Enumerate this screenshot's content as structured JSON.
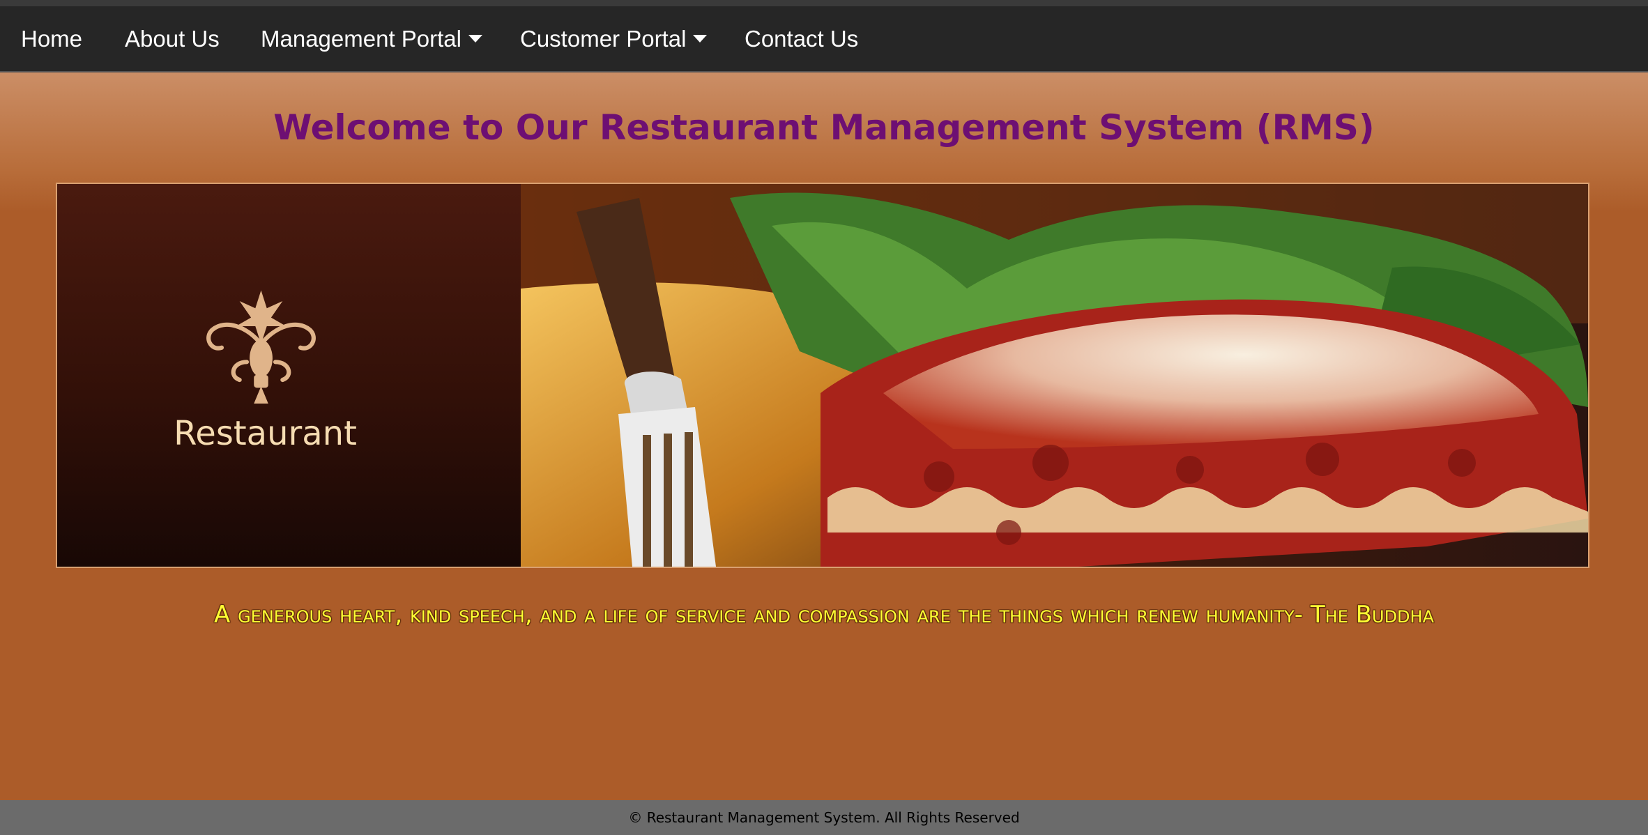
{
  "nav": {
    "home": "Home",
    "about": "About Us",
    "management": "Management Portal",
    "customer": "Customer Portal",
    "contact": "Contact Us"
  },
  "welcome": {
    "title": "Welcome to Our Restaurant Management System (RMS)"
  },
  "banner": {
    "brand_name": "Restaurant",
    "logo_icon": "fleur-ornament-icon",
    "photo": "lasagna-with-fork-photo"
  },
  "quote": {
    "text": "A generous heart, kind speech, and a life of service and compassion are the things which renew humanity- The Buddha"
  },
  "footer": {
    "text": "© Restaurant Management System. All Rights Reserved"
  },
  "colors": {
    "nav_bg": "#262626",
    "page_bg": "#ac5c29",
    "title": "#6d0f73",
    "quote": "#ffff33",
    "brand_text": "#f6dcb2",
    "footer_bg": "#6b6b6b"
  }
}
